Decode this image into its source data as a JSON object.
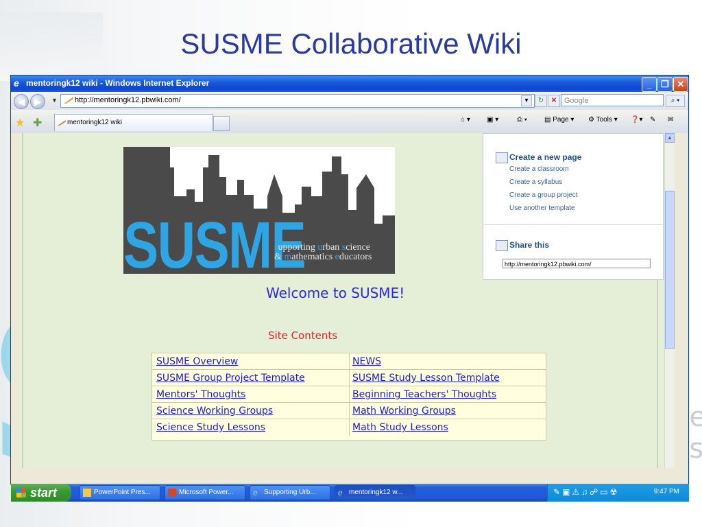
{
  "slide": {
    "title": "SUSME Collaborative Wiki"
  },
  "browser": {
    "window_title": "mentoringk12 wiki - Windows Internet Explorer",
    "url": "http://mentoringk12.pbwiki.com/",
    "search_placeholder": "Google",
    "tab_label": "mentoringk12 wiki",
    "toolbar": {
      "page_label": "Page",
      "tools_label": "Tools"
    }
  },
  "logo": {
    "big_text": "SUSME",
    "line1": {
      "a": "s",
      "b": "upporting ",
      "c": "u",
      "d": "rban ",
      "e": "s",
      "f": "cience"
    },
    "line2": {
      "a": "& ",
      "b": "m",
      "c": "athematics ",
      "d": "e",
      "e": "ducators"
    }
  },
  "sidebar": {
    "create_heading": "Create a new page",
    "templates": [
      "Create a classroom",
      "Create a syllabus",
      "Create a group project",
      "Use another template"
    ],
    "share_heading": "Share this",
    "share_url": "http://mentoringk12.pbwiki.com/"
  },
  "main": {
    "welcome": "Welcome to SUSME!",
    "contents_title": "Site Contents",
    "rows": [
      {
        "left": "SUSME Overview",
        "right": "NEWS"
      },
      {
        "left": "SUSME Group Project Template",
        "right": "SUSME Study Lesson Template"
      },
      {
        "left": "Mentors' Thoughts",
        "right": "Beginning Teachers' Thoughts"
      },
      {
        "left": "Science Working Groups",
        "right": "Math Working Groups"
      },
      {
        "left": "Science Study Lessons",
        "right": "Math Study Lessons"
      }
    ]
  },
  "taskbar": {
    "start_label": "start",
    "tasks": [
      "PowerPoint Pres...",
      "Microsoft Power...",
      "Supporting Urb...",
      "mentoringk12 w..."
    ],
    "clock": "9:47 PM"
  },
  "colors": {
    "accent": "#2a3a9e",
    "logo_blue": "#2ea5e5",
    "link": "#1a1ae6",
    "contents_red": "#e3262b"
  }
}
